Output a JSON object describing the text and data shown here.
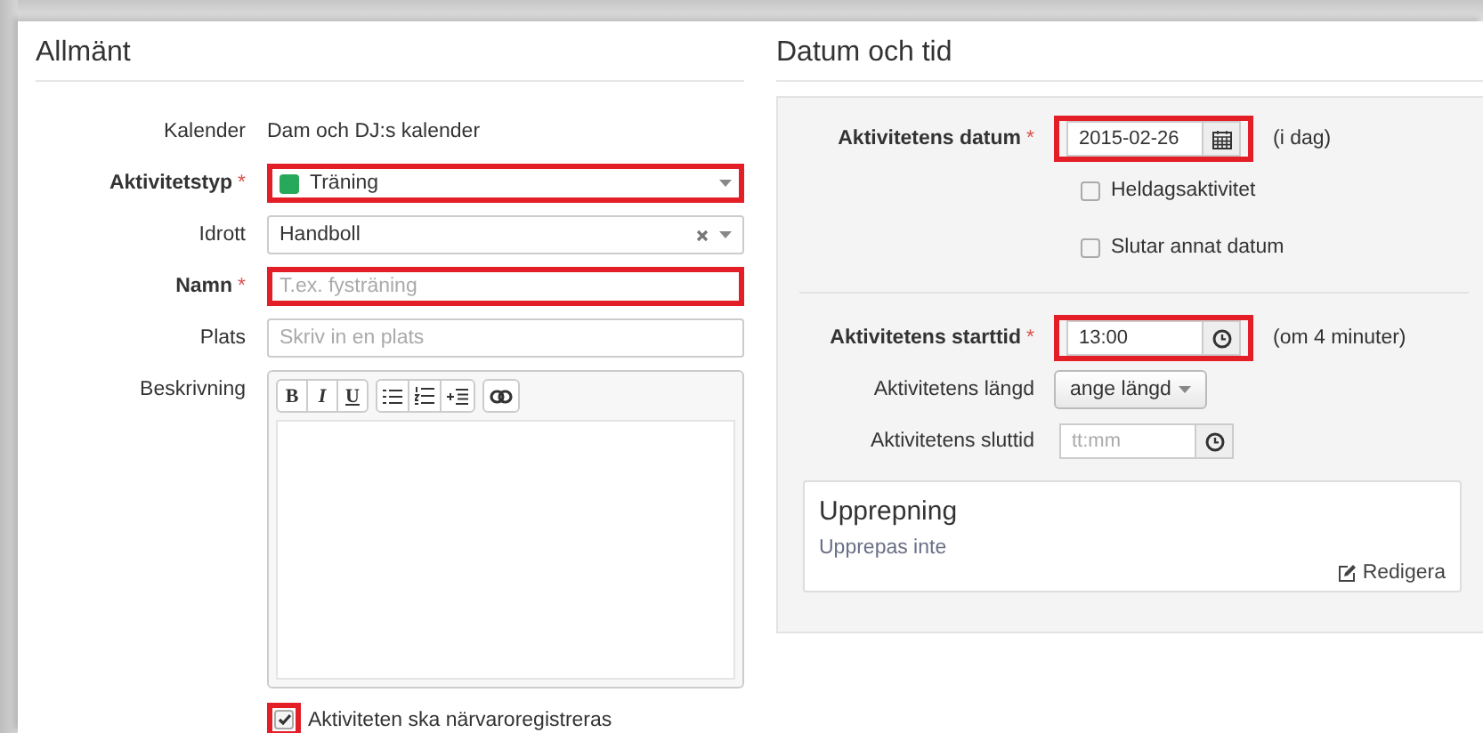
{
  "general": {
    "title": "Allmänt",
    "fields": [
      {
        "kind": "static",
        "label": "Kalender",
        "value": "Dam och DJ:s kalender"
      },
      {
        "kind": "select",
        "label": "Aktivitetstyp",
        "required_mark": "*",
        "value": "Träning",
        "color": "#27a85a",
        "highlighted": true
      },
      {
        "kind": "select",
        "label": "Idrott",
        "value": "Handboll",
        "clearable": true,
        "highlighted": false
      },
      {
        "kind": "input",
        "label": "Namn",
        "required_mark": "*",
        "placeholder": "T.ex. fysträning",
        "highlighted": true
      },
      {
        "kind": "input",
        "label": "Plats",
        "placeholder": "Skriv in en plats",
        "highlighted": false
      },
      {
        "kind": "editor",
        "label": "Beskrivning",
        "toolbar": [
          [
            {
              "kind": "bold",
              "label": "B"
            },
            {
              "kind": "italic",
              "label": "I"
            },
            {
              "kind": "underline",
              "label": "U"
            }
          ],
          [
            {
              "kind": "bullet-list"
            },
            {
              "kind": "numbered-list"
            },
            {
              "kind": "indent"
            }
          ],
          [
            {
              "kind": "link"
            }
          ]
        ]
      }
    ],
    "attendance": {
      "label": "Aktiviteten ska närvaroregistreras",
      "checked": true,
      "highlighted": true
    }
  },
  "date_time": {
    "title": "Datum och tid",
    "rows": [
      {
        "kind": "date",
        "label": "Aktivitetens datum",
        "required_mark": "*",
        "value": "2015-02-26",
        "note": "(i dag)",
        "highlighted": true
      },
      {
        "kind": "checkbox",
        "label": "Heldagsaktivitet",
        "checked": false
      },
      {
        "kind": "checkbox",
        "label": "Slutar annat datum",
        "checked": false
      },
      {
        "kind": "separator"
      },
      {
        "kind": "time",
        "label": "Aktivitetens starttid",
        "required_mark": "*",
        "value": "13:00",
        "note": "(om 4 minuter)",
        "highlighted": true
      },
      {
        "kind": "dropdown",
        "label": "Aktivitetens längd",
        "value": "ange längd"
      },
      {
        "kind": "time",
        "label": "Aktivitetens sluttid",
        "placeholder": "tt:mm",
        "highlighted": false
      }
    ],
    "repeat": {
      "title": "Upprepning",
      "text": "Upprepas inte",
      "link": "Redigera"
    }
  }
}
